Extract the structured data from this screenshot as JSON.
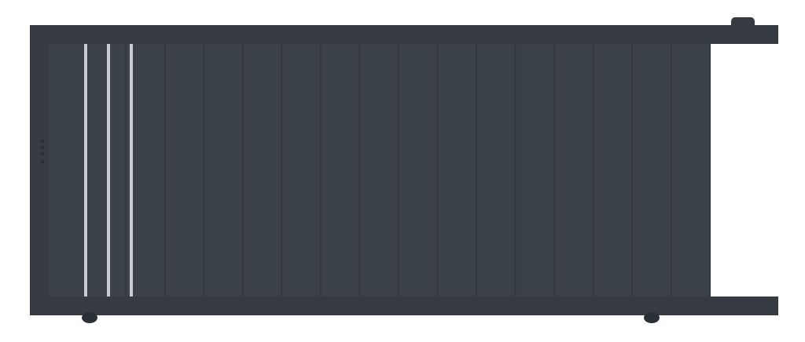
{
  "image": {
    "subject": "sliding-gate",
    "colors": {
      "frame": "#363b42",
      "frame_dark": "#2a2f35",
      "panel": "#3b4149",
      "panel_seam": "#30353b",
      "inlay": "#c9ccd0",
      "wheel": "#2b3036",
      "background": "#ffffff"
    },
    "vertical_slats": 17,
    "decorative_inlays": 3,
    "wheels": 2
  }
}
